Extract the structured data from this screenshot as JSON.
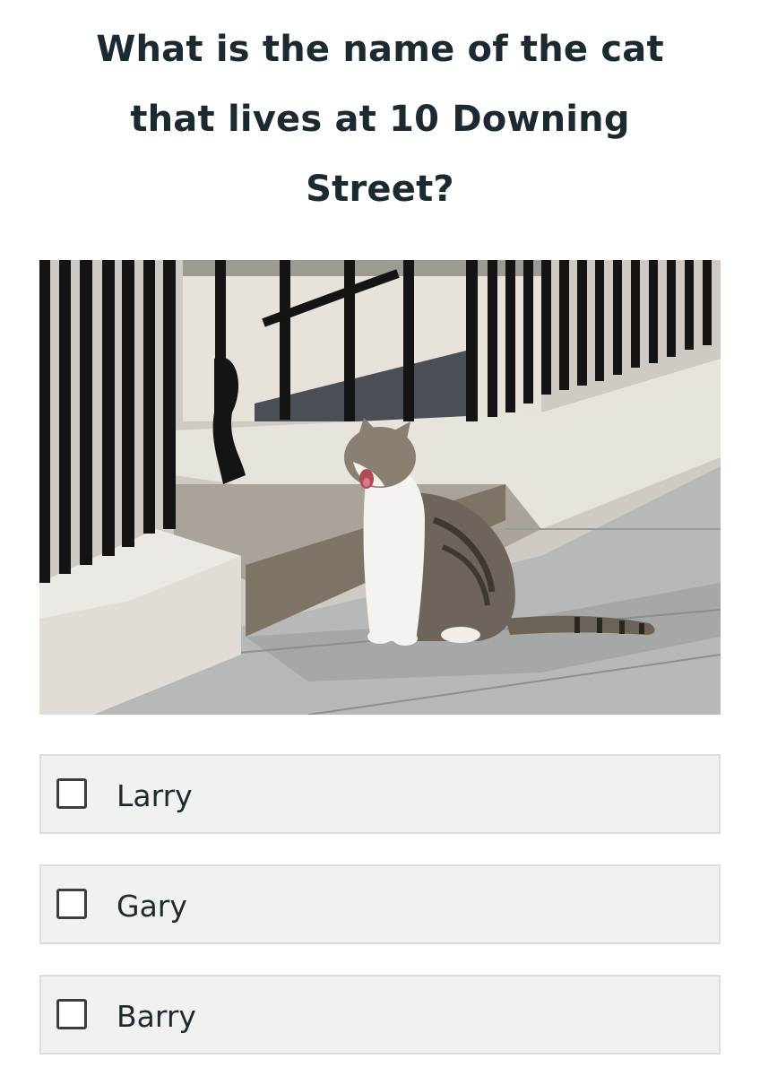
{
  "question": {
    "text": "What is the name of the cat that lives at 10 Downing Street?"
  },
  "photo": {
    "subject": "cat-sitting-on-pavement-by-railings"
  },
  "options": [
    {
      "label": "Larry",
      "checked": false
    },
    {
      "label": "Gary",
      "checked": false
    },
    {
      "label": "Barry",
      "checked": false
    }
  ],
  "colors": {
    "text": "#1b2a30",
    "option_background": "#f1f1f1",
    "option_border": "#dcdcdc",
    "checkbox_border": "#3a3f42"
  }
}
